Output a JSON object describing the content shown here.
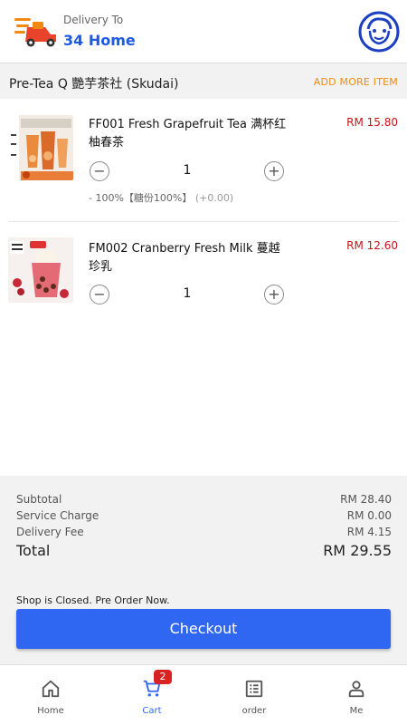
{
  "header": {
    "delivery_label": "Delivery To",
    "delivery_address": "34 Home",
    "accent_color": "#1e5adf"
  },
  "shop": {
    "name": "Pre-Tea Q 艷芋茶社 (Skudai)",
    "add_more_label": "ADD MORE ITEM"
  },
  "items": [
    {
      "name": "FF001 Fresh Grapefruit Tea 满杯红柚春茶",
      "price": "RM 15.80",
      "quantity": "1",
      "minus": "−",
      "plus": "+",
      "option": "- 100%【糖份100%】",
      "option_price": "(+0.00)"
    },
    {
      "name": "FM002 Cranberry Fresh Milk 蔓越珍乳",
      "price": "RM 12.60",
      "quantity": "1",
      "minus": "−",
      "plus": "+"
    }
  ],
  "summary": {
    "subtotal_label": "Subtotal",
    "subtotal_value": "RM 28.40",
    "service_label": "Service Charge",
    "service_value": "RM 0.00",
    "delivery_label": "Delivery Fee",
    "delivery_value": "RM 4.15",
    "total_label": "Total",
    "total_value": "RM 29.55"
  },
  "notice": "Shop is Closed. Pre Order Now.",
  "checkout_label": "Checkout",
  "nav": {
    "home": "Home",
    "cart": "Cart",
    "cart_badge": "2",
    "order": "order",
    "me": "Me"
  },
  "colors": {
    "price": "#c41616",
    "add_more": "#f08a12",
    "checkout": "#2f66f2",
    "badge": "#d92323"
  }
}
